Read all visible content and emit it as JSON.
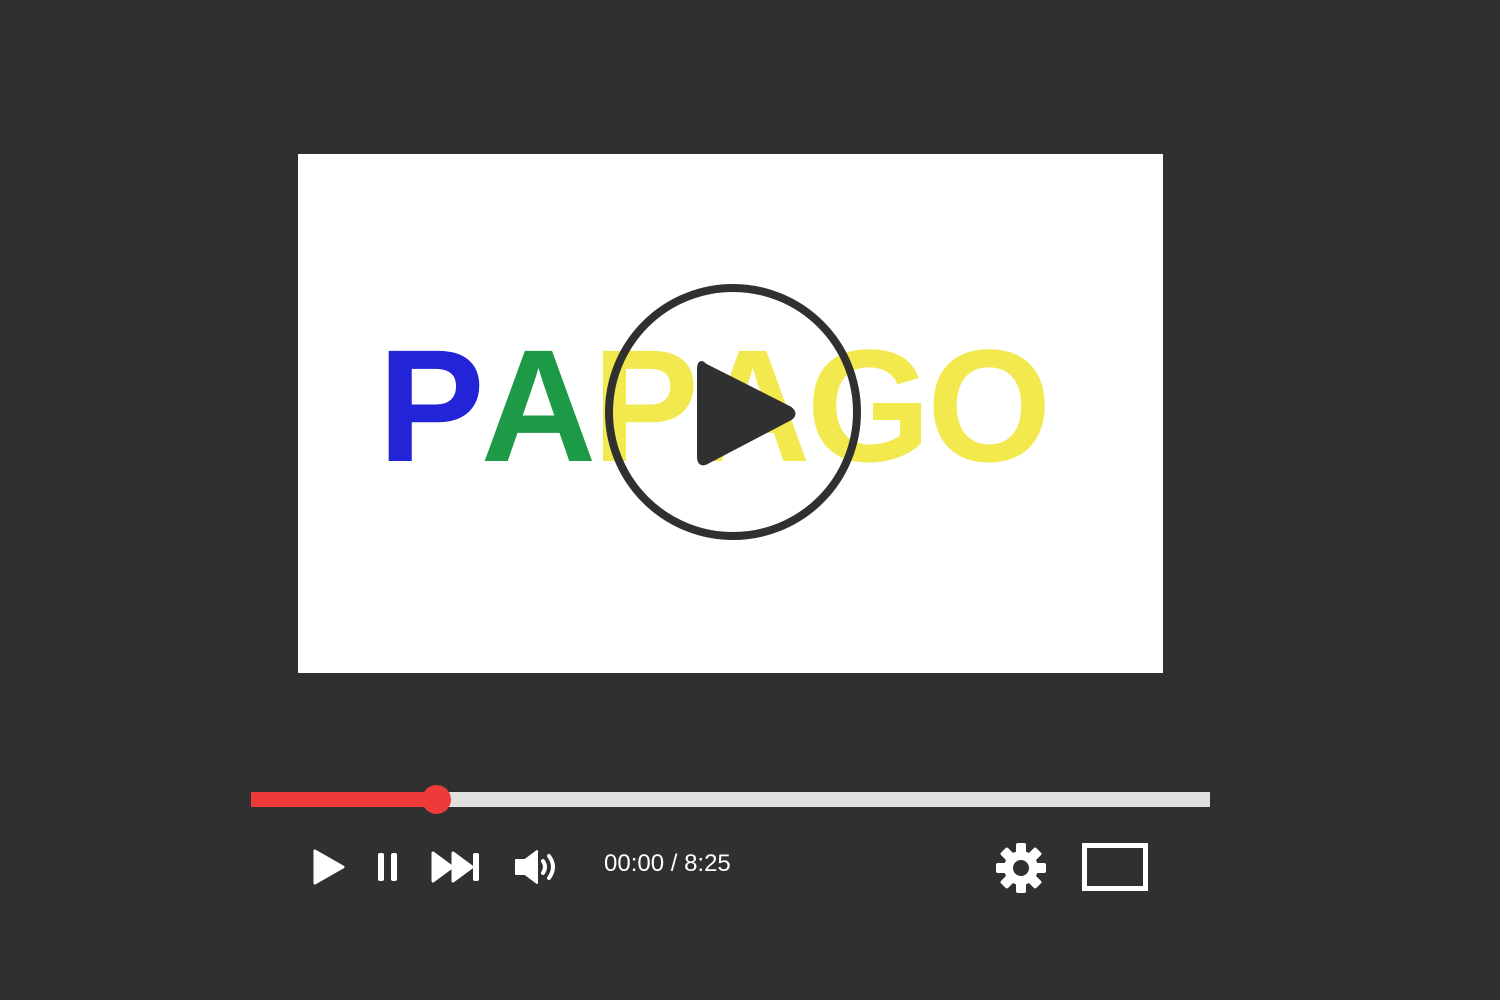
{
  "video": {
    "logo_letters": [
      {
        "char": "P",
        "color": "#2323d8"
      },
      {
        "char": "A",
        "color": "#1c9a46"
      },
      {
        "char": "P",
        "color": "#f2e94e"
      },
      {
        "char": "A",
        "color": "#f2e94e"
      },
      {
        "char": "G",
        "color": "#f2e94e"
      },
      {
        "char": "O",
        "color": "#f2e94e"
      }
    ],
    "overlay_icon": "play-circle-icon"
  },
  "player": {
    "progress_fraction": 0.193,
    "progress_color": "#ef3a3a",
    "time_display": "00:00 / 8:25",
    "controls": {
      "play_icon": "play-icon",
      "pause_icon": "pause-icon",
      "next_icon": "skip-next-icon",
      "volume_icon": "volume-icon",
      "settings_icon": "gear-icon",
      "fullscreen_icon": "fullscreen-icon"
    }
  }
}
